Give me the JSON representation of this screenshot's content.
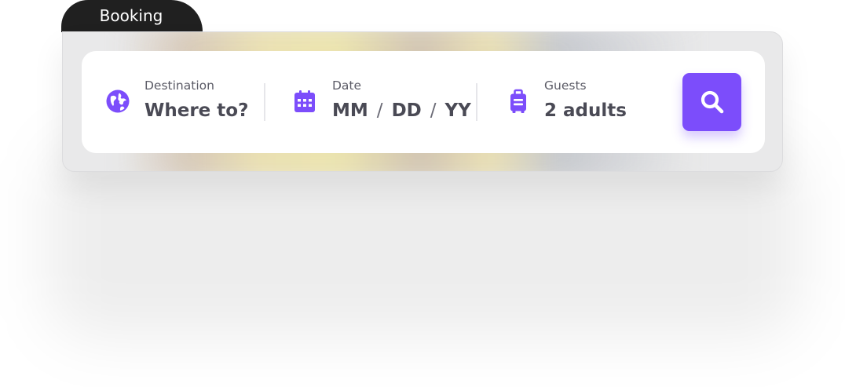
{
  "tab": {
    "label": "Booking"
  },
  "fields": {
    "destination": {
      "label": "Destination",
      "value": "Where to?",
      "icon": "globe-icon"
    },
    "date": {
      "label": "Date",
      "month": "MM",
      "day": "DD",
      "year": "YY",
      "separator": "/",
      "icon": "calendar-icon"
    },
    "guests": {
      "label": "Guests",
      "value": "2 adults",
      "icon": "luggage-icon"
    }
  },
  "search": {
    "icon": "search-icon"
  },
  "colors": {
    "accent": "#7c4dfb",
    "tab_bg": "#202020",
    "label_text": "#5b5b66",
    "value_text": "#4a4a55"
  }
}
